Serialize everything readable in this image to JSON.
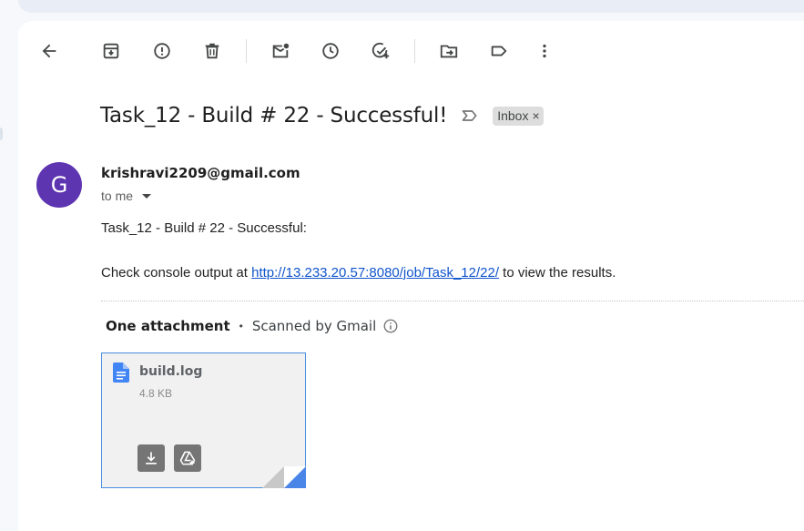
{
  "toolbar": {
    "icons": [
      "back-arrow-icon",
      "archive-icon",
      "report-spam-icon",
      "delete-icon",
      "mark-unread-icon",
      "snooze-icon",
      "add-to-tasks-icon",
      "move-to-icon",
      "label-icon",
      "more-vert-icon"
    ]
  },
  "email": {
    "subject": "Task_12 - Build # 22 - Successful!",
    "label_chip": "Inbox",
    "label_remove": "×",
    "avatar_letter": "G",
    "sender": "krishravi2209@gmail.com",
    "to": "to me",
    "body_line1": "Task_12 - Build # 22 - Successful:",
    "body_prefix": "Check console output at ",
    "body_link": "http://13.233.20.57:8080/job/Task_12/22/",
    "body_suffix": " to view the results."
  },
  "attachments": {
    "header": "One attachment",
    "separator": "•",
    "scanned": "Scanned by Gmail",
    "file": {
      "name": "build.log",
      "size": "4.8 KB"
    }
  },
  "colors": {
    "avatar": "#5e35b1",
    "link": "#1155cc",
    "doc_icon": "#4285f4",
    "attachment_border": "#4a90e2"
  }
}
